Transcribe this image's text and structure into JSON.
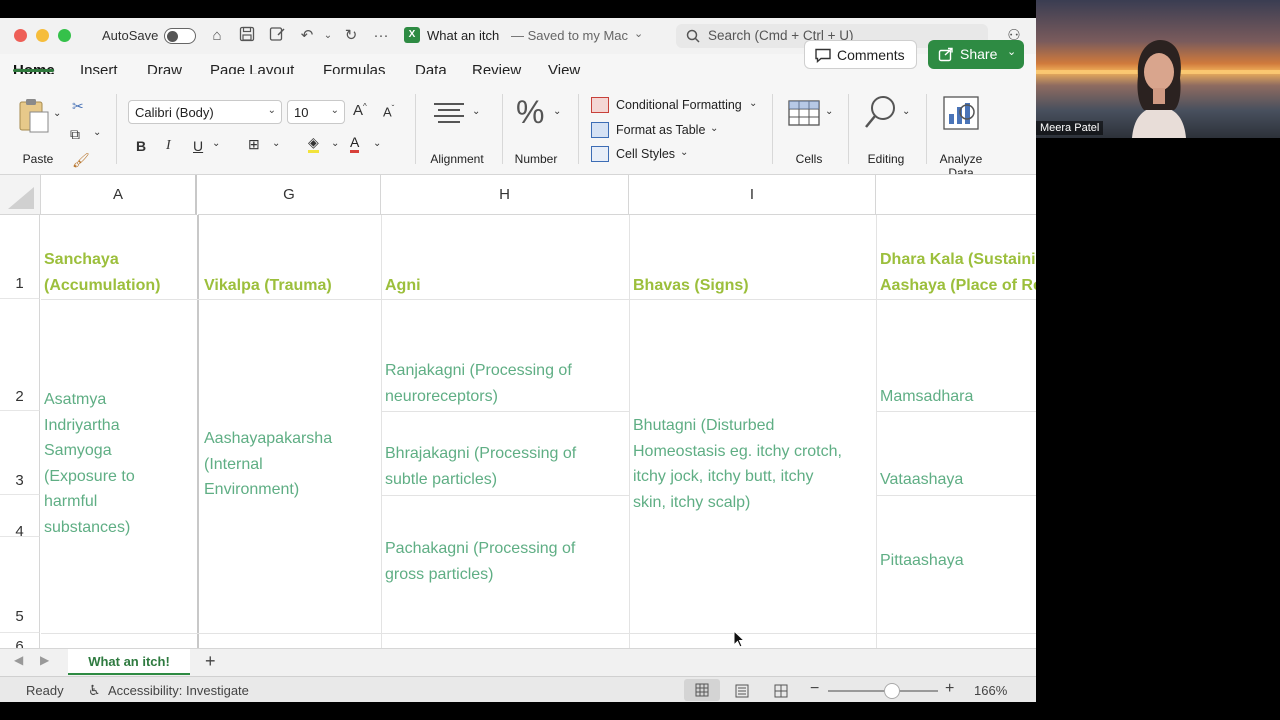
{
  "window": {
    "autosave_label": "AutoSave",
    "doc_title": "What an itch",
    "saved_status": "— Saved to my Mac",
    "search_placeholder": "Search (Cmd + Ctrl + U)"
  },
  "tabs": [
    "Home",
    "Insert",
    "Draw",
    "Page Layout",
    "Formulas",
    "Data",
    "Review",
    "View"
  ],
  "actions": {
    "comments": "Comments",
    "share": "Share"
  },
  "ribbon": {
    "paste": "Paste",
    "font_name": "Calibri (Body)",
    "font_size": "10",
    "bold": "B",
    "italic": "I",
    "underline": "U",
    "alignment": "Alignment",
    "number": "Number",
    "conditional_formatting": "Conditional Formatting",
    "format_as_table": "Format as Table",
    "cell_styles": "Cell Styles",
    "cells": "Cells",
    "editing": "Editing",
    "analyze": "Analyze",
    "analyze2": "Data"
  },
  "columns": [
    "A",
    "G",
    "H",
    "I"
  ],
  "rows": [
    "1",
    "2",
    "3",
    "4",
    "5",
    "6"
  ],
  "cells": {
    "a1": [
      "Sanchaya",
      "(Accumulation)"
    ],
    "g1": "Vikalpa (Trauma)",
    "h1": "Agni",
    "i1": "Bhavas (Signs)",
    "j1": [
      "Dhara Kala (Sustaini",
      "Aashaya (Place of Re"
    ],
    "a2": [
      "Asatmya",
      "Indriyartha",
      "Samyoga",
      "(Exposure to",
      "harmful",
      "substances)"
    ],
    "g2": [
      "Aashayapakarsha",
      "(Internal",
      "Environment)"
    ],
    "h2": [
      "Ranjakagni (Processing of",
      "neuroreceptors)"
    ],
    "h3": [
      "Bhrajakagni (Processing of",
      "subtle particles)"
    ],
    "h4": [
      "Pachakagni (Processing of",
      "gross particles)"
    ],
    "i2": [
      "Bhutagni (Disturbed",
      "Homeostasis eg. itchy crotch,",
      "itchy jock, itchy butt, itchy",
      "skin, itchy scalp)"
    ],
    "j2": "Mamsadhara",
    "j3": "Vataashaya",
    "j4": "Pittaashaya"
  },
  "sheet_tab": "What an itch!",
  "status": {
    "ready": "Ready",
    "accessibility": "Accessibility: Investigate",
    "zoom": "166%"
  },
  "video": {
    "participant": "Meera Patel"
  },
  "colors": {
    "accent": "#2e8b43",
    "header_text": "#9cbf3c",
    "cell_text": "#5fae84"
  }
}
